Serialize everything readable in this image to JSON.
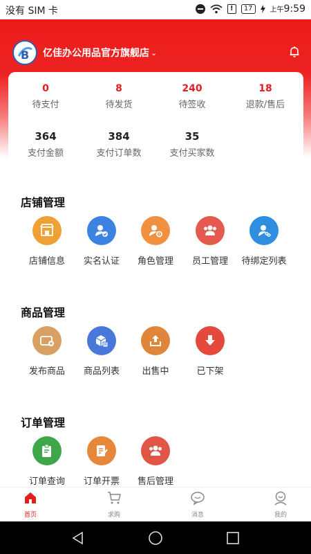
{
  "status_bar": {
    "carrier": "没有 SIM 卡",
    "battery": "17",
    "time_prefix": "上午",
    "time": "9:59"
  },
  "header": {
    "store_name": "亿佳办公用品官方旗舰店",
    "chevron": "⌄"
  },
  "stats": {
    "row1": [
      {
        "value": "0",
        "label": "待支付"
      },
      {
        "value": "8",
        "label": "待发货"
      },
      {
        "value": "240",
        "label": "待签收"
      },
      {
        "value": "18",
        "label": "退款/售后"
      }
    ],
    "row2": [
      {
        "value": "364",
        "label": "支付金额"
      },
      {
        "value": "384",
        "label": "支付订单数"
      },
      {
        "value": "35",
        "label": "支付买家数"
      }
    ]
  },
  "sections": {
    "store": {
      "title": "店铺管理",
      "items": [
        {
          "label": "店铺信息",
          "icon": "storefront-icon",
          "color": "#f0a135"
        },
        {
          "label": "实名认证",
          "icon": "verified-user-icon",
          "color": "#3c82e0"
        },
        {
          "label": "角色管理",
          "icon": "user-settings-icon",
          "color": "#ef9140"
        },
        {
          "label": "员工管理",
          "icon": "team-icon",
          "color": "#e55a4e"
        },
        {
          "label": "待绑定列表",
          "icon": "user-link-icon",
          "color": "#2f8ee0"
        }
      ]
    },
    "product": {
      "title": "商品管理",
      "items": [
        {
          "label": "发布商品",
          "icon": "card-add-icon",
          "color": "#d9a063"
        },
        {
          "label": "商品列表",
          "icon": "box-list-icon",
          "color": "#4a78d8"
        },
        {
          "label": "出售中",
          "icon": "upload-box-icon",
          "color": "#e0863a"
        },
        {
          "label": "已下架",
          "icon": "download-arrow-icon",
          "color": "#e5493e"
        }
      ]
    },
    "order": {
      "title": "订单管理",
      "items": [
        {
          "label": "订单查询",
          "icon": "clipboard-search-icon",
          "color": "#3fa64a"
        },
        {
          "label": "订单开票",
          "icon": "invoice-icon",
          "color": "#e6873a"
        },
        {
          "label": "售后管理",
          "icon": "support-team-icon",
          "color": "#e05545"
        }
      ]
    }
  },
  "bottom_nav": [
    {
      "label": "首页",
      "icon": "home-icon",
      "active": true
    },
    {
      "label": "求购",
      "icon": "cart-icon",
      "active": false
    },
    {
      "label": "消息",
      "icon": "message-icon",
      "active": false
    },
    {
      "label": "我的",
      "icon": "profile-icon",
      "active": false
    }
  ]
}
